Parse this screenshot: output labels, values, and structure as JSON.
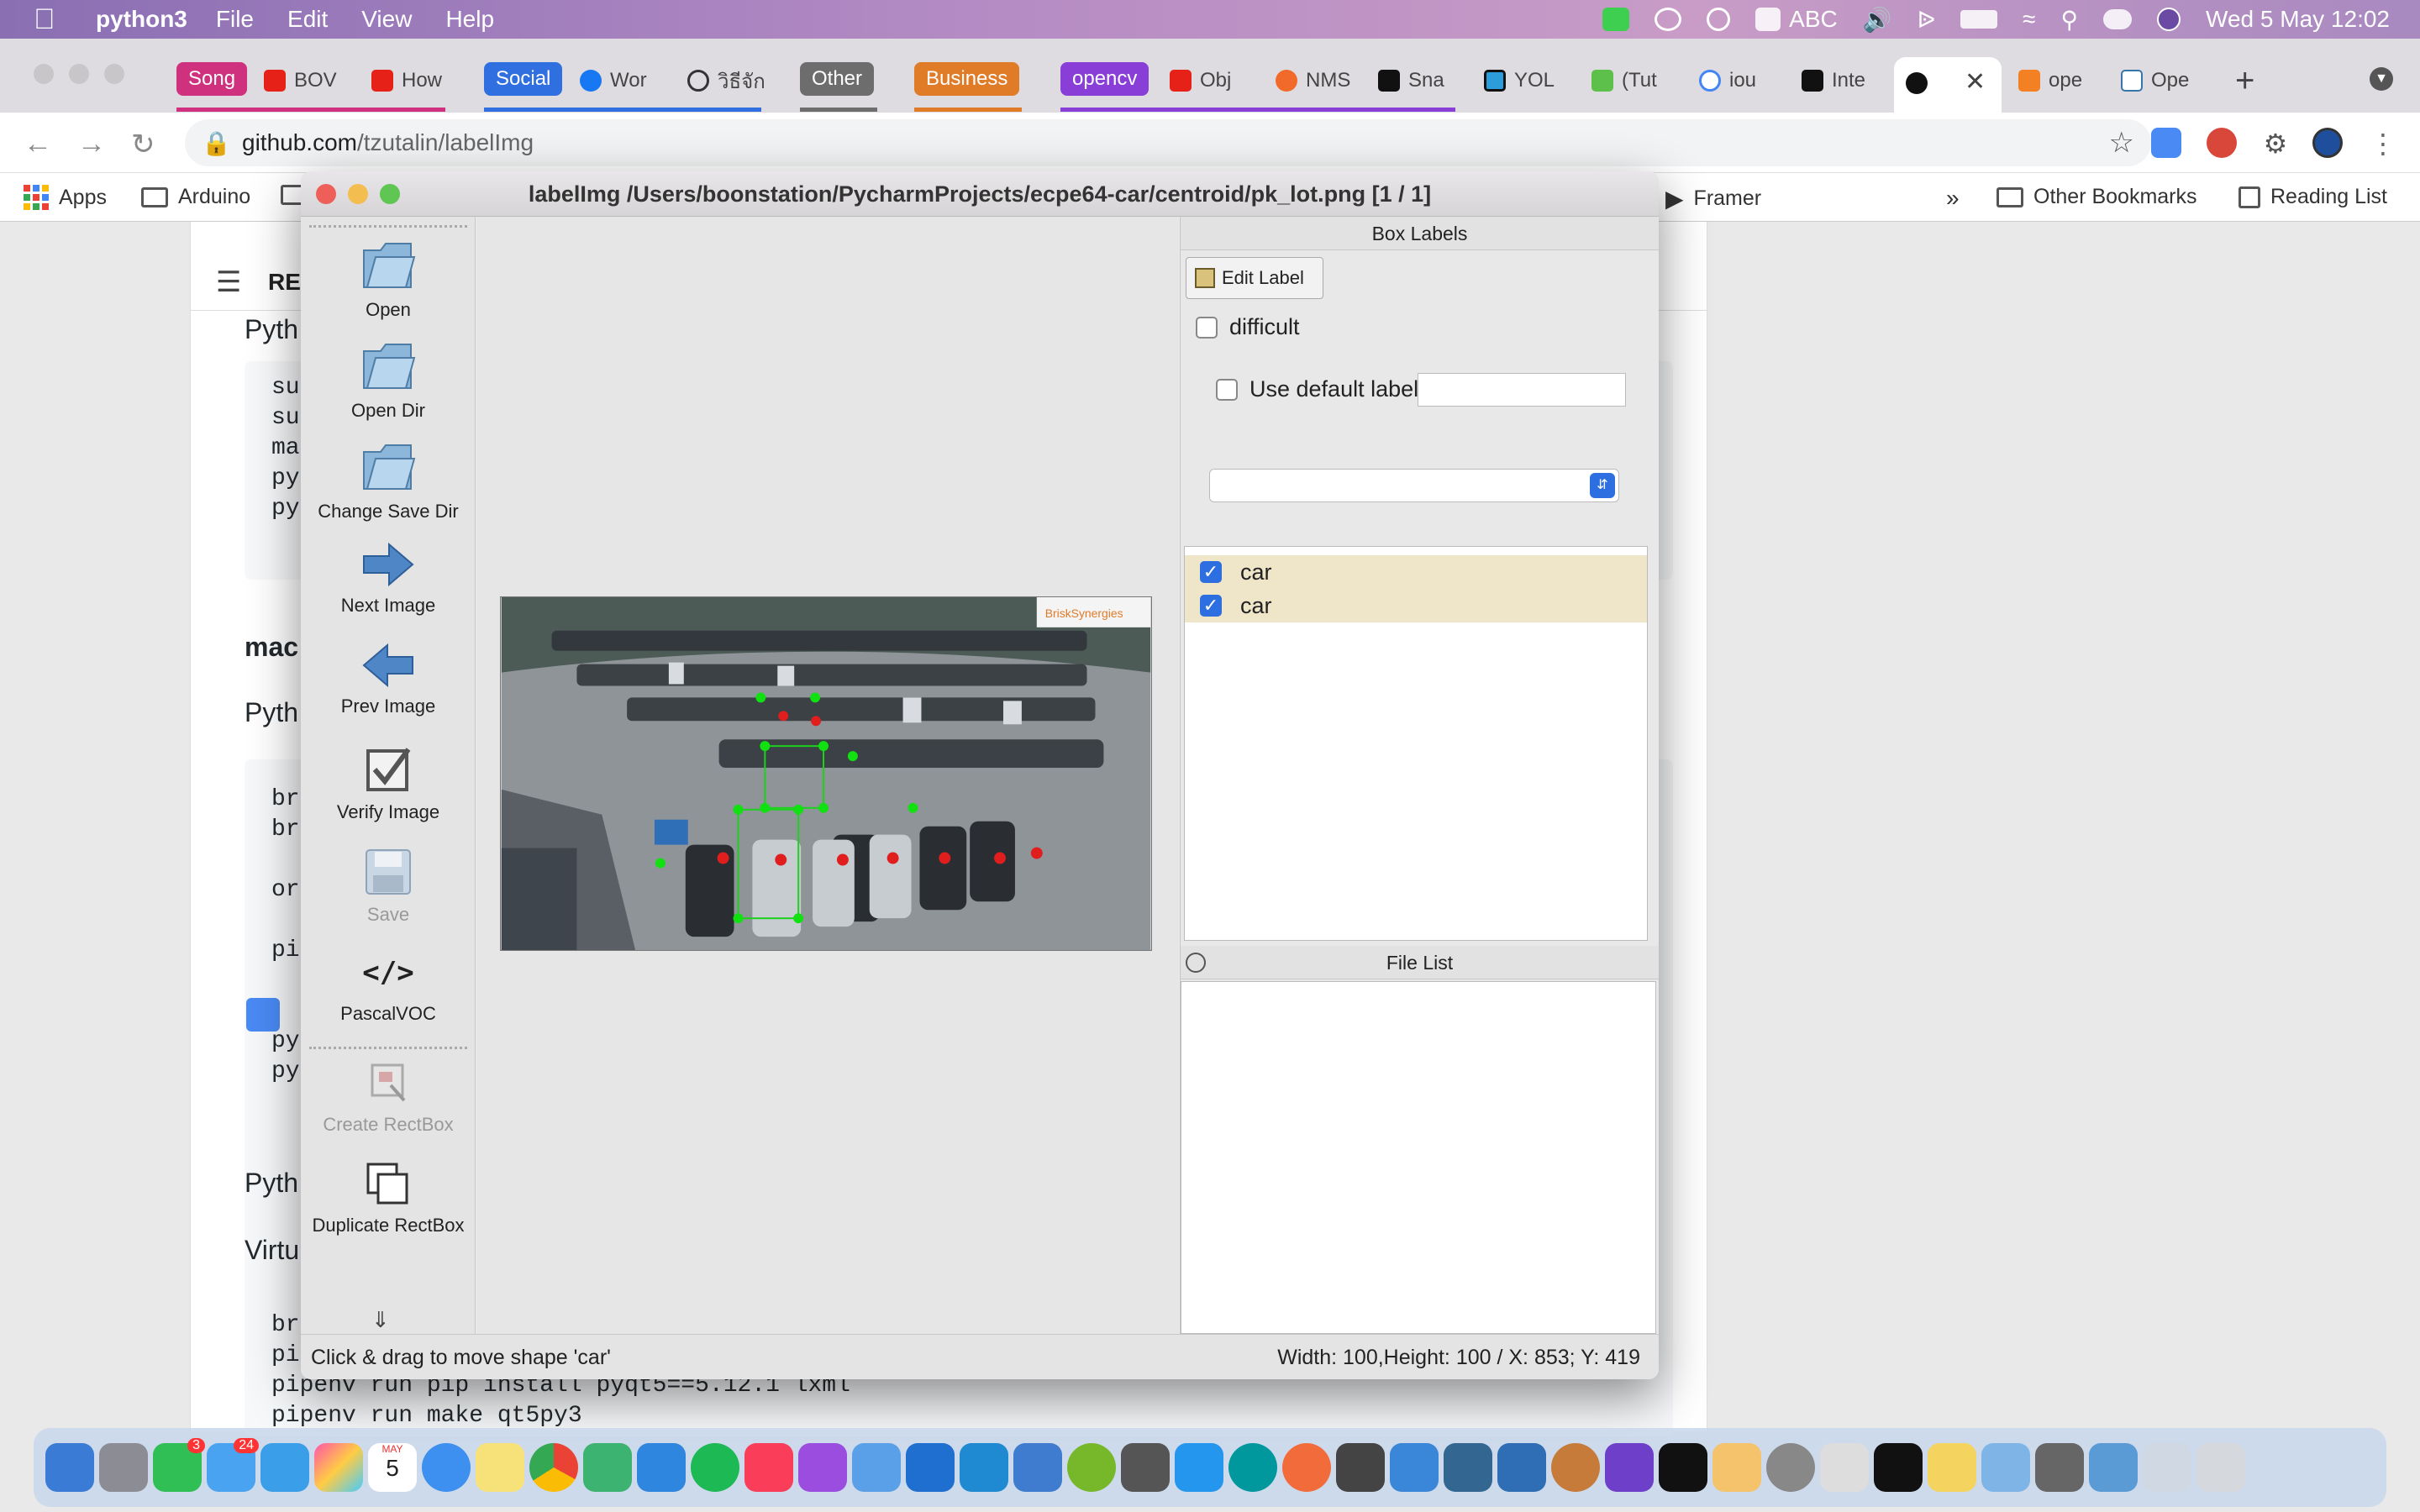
{
  "menubar": {
    "app": "python3",
    "items": [
      "File",
      "Edit",
      "View",
      "Help"
    ],
    "input_source": "ABC",
    "clock": "Wed 5 May  12:02"
  },
  "browser": {
    "tab_groups": [
      {
        "label": "Song",
        "color": "#d0317f"
      },
      {
        "label": "Social",
        "color": "#2f6fdf"
      },
      {
        "label": "Other",
        "color": "#6d6d6d"
      },
      {
        "label": "Business",
        "color": "#e07b28"
      },
      {
        "label": "opencv",
        "color": "#8a3ed8"
      }
    ],
    "tabs": [
      "BOV",
      "How",
      "Wor",
      "วิธีจัก",
      "Obj",
      "NMS",
      "Sna",
      "YOL",
      "(Tut",
      "iou",
      "Inte",
      "",
      "ope",
      "Ope"
    ],
    "url_host": "github.com",
    "url_path": "/tzutalin/labelImg",
    "bookmarks": [
      "Apps",
      "Arduino",
      "Framer",
      "Other Bookmarks",
      "Reading List"
    ],
    "bookmark_overflow": "»"
  },
  "github": {
    "readme_label": "RE",
    "lines": {
      "l1": "Pyth",
      "l2": "mac",
      "l3": "Pyth",
      "l4": "Pyth",
      "l5": "Virtu"
    },
    "code1": [
      "su",
      "su",
      "ma",
      "py",
      "py"
    ],
    "code2": [
      "bre",
      "bre",
      "",
      "or",
      "",
      "pi",
      "",
      "",
      "py",
      "py"
    ],
    "code3": [
      "bre",
      "pip",
      "pipenv run pip install pyqt5==5.12.1 lxml",
      "pipenv run make qt5py3"
    ]
  },
  "labelimg": {
    "title": "labelImg /Users/boonstation/PycharmProjects/ecpe64-car/centroid/pk_lot.png [1 / 1]",
    "tools": {
      "open": "Open",
      "open_dir": "Open Dir",
      "change_save_dir": "Change Save Dir",
      "next_image": "Next Image",
      "prev_image": "Prev Image",
      "verify_image": "Verify Image",
      "save": "Save",
      "format": "PascalVOC",
      "create_rectbox": "Create RectBox",
      "duplicate_rectbox": "Duplicate RectBox"
    },
    "box_labels_title": "Box Labels",
    "edit_label": "Edit Label",
    "difficult": "difficult",
    "use_default_label": "Use default label",
    "default_label_value": "",
    "label_items": [
      {
        "label": "car",
        "checked": true
      },
      {
        "label": "car",
        "checked": true
      }
    ],
    "file_list_title": "File List",
    "watermark": "BriskSynergies",
    "status_left": "Click & drag to move shape 'car'",
    "status_right": "Width: 100,Height: 100 / X: 853; Y: 419"
  },
  "dock": {
    "badges": [
      "3",
      "24"
    ],
    "calendar_month": "MAY",
    "calendar_day": "5"
  }
}
